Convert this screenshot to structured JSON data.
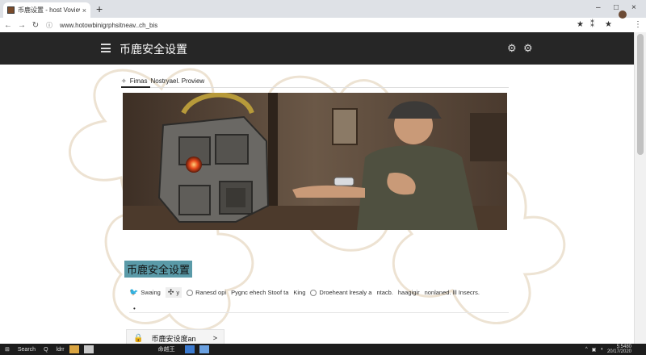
{
  "browser": {
    "tab_title": "币鹿设置 - host Voview",
    "tab_close": "×",
    "new_tab": "+",
    "url": "www.hotowbinigrphsitneav..ch_bis",
    "window_controls": [
      "–",
      "□",
      "×"
    ],
    "toolbar_icons": [
      "star-icon",
      "extensions-icon",
      "bookmark-star-icon",
      "profile-avatar",
      "more-icon"
    ]
  },
  "header": {
    "title": "币鹿安全设置",
    "icons": [
      "menu-icon",
      "gear-icon",
      "settings-alt-icon"
    ]
  },
  "breadcrumb": {
    "items": [
      "Fimas",
      "Nostryael. Proview"
    ]
  },
  "section": {
    "title": "币鹿安全设置"
  },
  "filters": {
    "items": [
      {
        "label": "Swaing",
        "icon": "bird-icon"
      },
      {
        "label": "y",
        "icon": "pinwheel-icon"
      },
      {
        "label": "Ranesd opi",
        "icon": "radio"
      },
      {
        "label": "Pygnc ehech Stoof ta",
        "icon": ""
      },
      {
        "label": "King",
        "icon": ""
      },
      {
        "label": "Droeheant lresaly a",
        "icon": "radio"
      },
      {
        "label": "ntacb.",
        "icon": ""
      },
      {
        "label": "haagigir",
        "icon": ""
      },
      {
        "label": "nonlaned. lll Insecrs.",
        "icon": ""
      }
    ]
  },
  "card": {
    "label": "币鹿安设度an",
    "icon": "lock-icon",
    "chevron": ">"
  },
  "taskbar": {
    "items": [
      "Search",
      "Q",
      "ldrr"
    ],
    "task_label": "命越王",
    "clock_time": "5:5480",
    "clock_date": "20/17/2020"
  },
  "colors": {
    "appbar": "#262626",
    "title_highlight": "#5a9aa8",
    "taskbar": "#1c1c1c"
  }
}
